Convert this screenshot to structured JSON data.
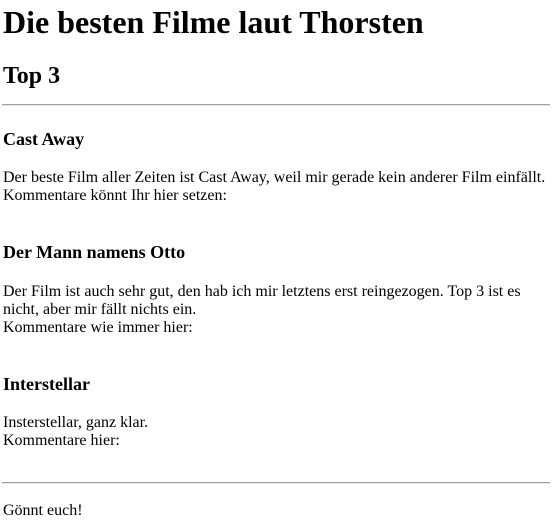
{
  "page": {
    "title": "Die besten Filme laut Thorsten",
    "subtitle": "Top 3"
  },
  "movies": [
    {
      "title": "Cast Away",
      "description": "Der beste Film aller Zeiten ist Cast Away, weil mir gerade kein anderer Film einfällt.",
      "comment_prompt": "Kommentare könnt Ihr hier setzen:"
    },
    {
      "title": "Der Mann namens Otto",
      "description": "Der Film ist auch sehr gut, den hab ich mir letztens erst reingezogen. Top 3 ist es nicht, aber mir fällt nichts ein.",
      "comment_prompt": "Kommentare wie immer hier:"
    },
    {
      "title": "Interstellar",
      "description": "Insterstellar, ganz klar.",
      "comment_prompt": "Kommentare hier:"
    }
  ],
  "footer": {
    "text": "Gönnt euch!"
  }
}
